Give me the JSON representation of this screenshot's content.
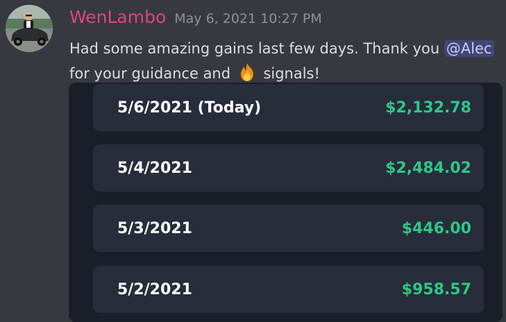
{
  "message": {
    "username": "WenLambo",
    "timestamp": "May 6, 2021 10:27 PM",
    "text_part1": "Had some amazing gains last few days. Thank you ",
    "mention": "@Alec",
    "text_part2": "for your guidance and ",
    "emoji": "fire-emoji",
    "text_part3": " signals!"
  },
  "gains": [
    {
      "date": "5/6/2021 (Today)",
      "amount": "$2,132.78"
    },
    {
      "date": "5/4/2021",
      "amount": "$2,484.02"
    },
    {
      "date": "5/3/2021",
      "amount": "$446.00"
    },
    {
      "date": "5/2/2021",
      "amount": "$958.57"
    }
  ],
  "colors": {
    "background": "#36393f",
    "username": "#e0457a",
    "amount": "#2fc786",
    "mention_bg": "#414675"
  }
}
